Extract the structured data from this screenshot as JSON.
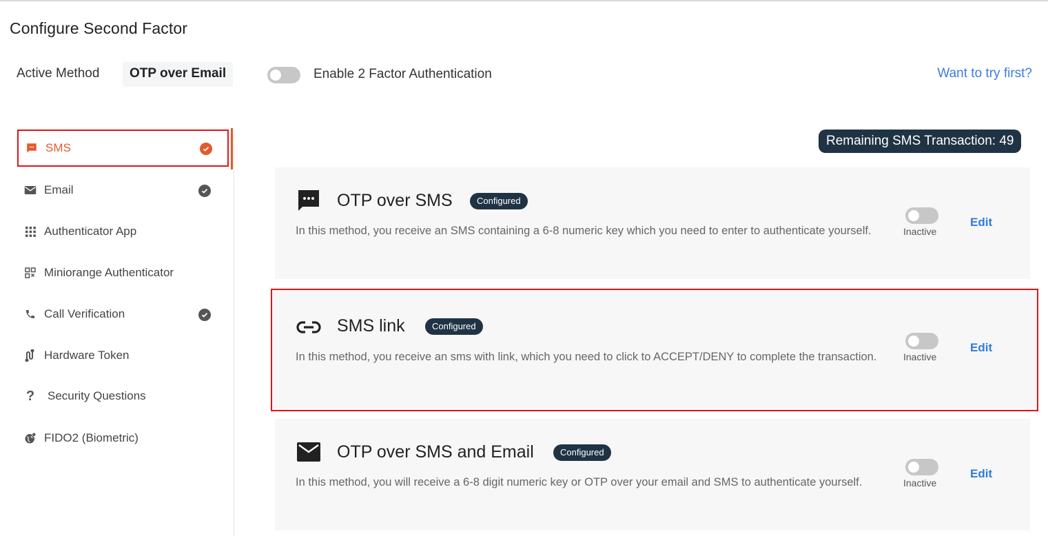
{
  "header": {
    "title": "Configure Second Factor",
    "active_method_label": "Active Method",
    "active_method_value": "OTP over Email",
    "enable_2fa_label": "Enable 2 Factor Authentication",
    "enable_2fa_on": false,
    "try_link": "Want to try first?"
  },
  "sidebar": {
    "items": [
      {
        "label": "SMS",
        "icon": "sms-icon",
        "checked": true,
        "selected": true
      },
      {
        "label": "Email",
        "icon": "email-icon",
        "checked": true,
        "selected": false
      },
      {
        "label": "Authenticator App",
        "icon": "grid-icon",
        "checked": false,
        "selected": false
      },
      {
        "label": "Miniorange Authenticator",
        "icon": "qr-code-icon",
        "checked": false,
        "selected": false
      },
      {
        "label": "Call Verification",
        "icon": "phone-icon",
        "checked": true,
        "selected": false
      },
      {
        "label": "Hardware Token",
        "icon": "hardware-token-icon",
        "checked": false,
        "selected": false
      },
      {
        "label": "Security Questions",
        "icon": "question-icon",
        "checked": false,
        "selected": false
      },
      {
        "label": "FIDO2 (Biometric)",
        "icon": "globe-lock-icon",
        "checked": false,
        "selected": false
      }
    ]
  },
  "main": {
    "remaining_label": "Remaining SMS Transaction: 49",
    "methods": [
      {
        "title": "OTP over SMS",
        "icon": "chat-bubble-icon",
        "badge": "Configured",
        "description": "In this method, you receive an SMS containing a 6-8 numeric key which you need to enter to authenticate yourself.",
        "status": "Inactive",
        "active": false,
        "edit_label": "Edit"
      },
      {
        "title": "SMS link",
        "icon": "link-icon",
        "badge": "Configured",
        "description": "In this method, you receive an sms with link, which you need to click to ACCEPT/DENY to complete the transaction.",
        "status": "Inactive",
        "active": false,
        "edit_label": "Edit"
      },
      {
        "title": "OTP over SMS and Email",
        "icon": "envelope-icon",
        "badge": "Configured",
        "description": "In this method, you will receive a 6-8 digit numeric key or OTP over your email and SMS to authenticate yourself.",
        "status": "Inactive",
        "active": false,
        "edit_label": "Edit"
      }
    ]
  },
  "colors": {
    "accent": "#e25a2b",
    "badge_bg": "#1f3344",
    "link": "#2f7bde",
    "highlight": "#e01515"
  }
}
